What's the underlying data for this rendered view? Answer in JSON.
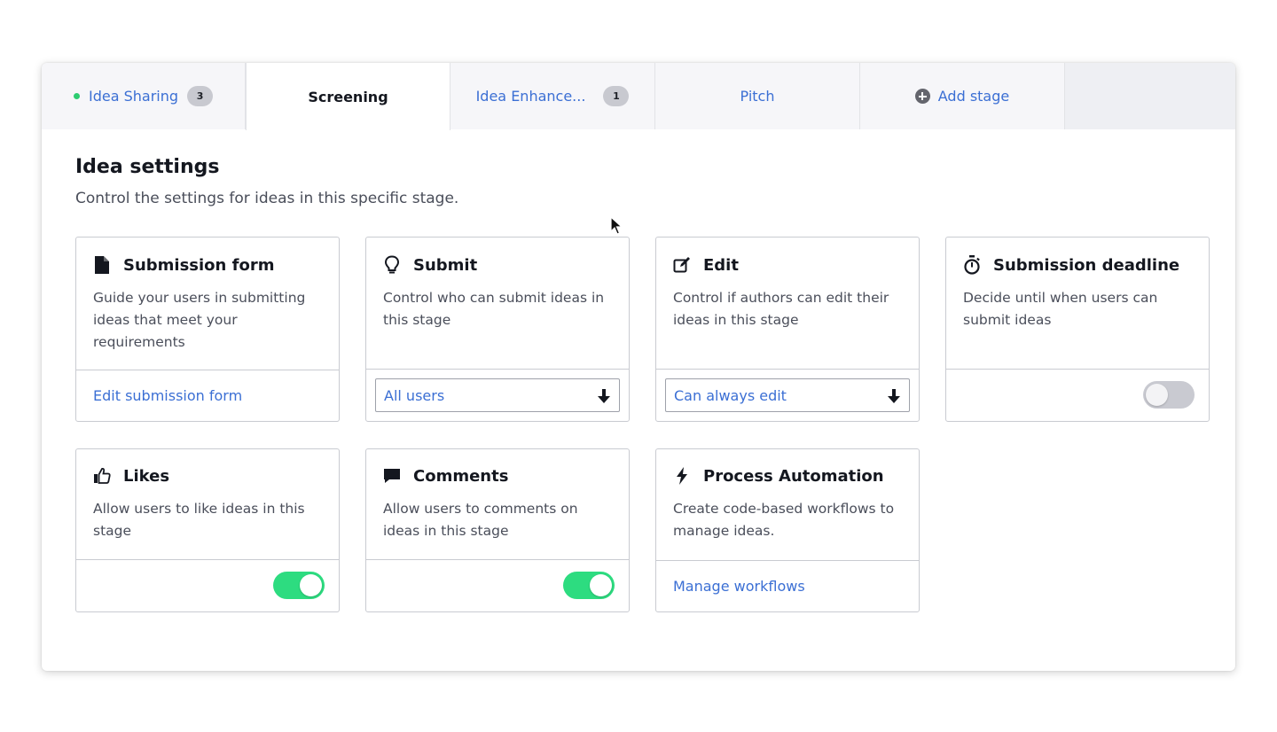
{
  "tabs": [
    {
      "label": "Idea Sharing",
      "badge": "3",
      "status_color": "#2ecc71"
    },
    {
      "label": "Screening",
      "active": true
    },
    {
      "label": "Idea Enhance...",
      "badge": "1"
    },
    {
      "label": "Pitch"
    },
    {
      "label": "Add stage",
      "icon": "plus-circle-icon"
    }
  ],
  "header": {
    "title": "Idea settings",
    "subtitle": "Control the settings for ideas in this specific stage."
  },
  "cards": {
    "submission_form": {
      "icon": "document-icon",
      "title": "Submission form",
      "description": "Guide your users in submitting ideas that meet your requirements",
      "link": "Edit submission form"
    },
    "submit": {
      "icon": "lightbulb-icon",
      "title": "Submit",
      "description": "Control who can submit ideas in this stage",
      "select_value": "All users"
    },
    "edit": {
      "icon": "edit-icon",
      "title": "Edit",
      "description": "Control if authors can edit their ideas in this stage",
      "select_value": "Can always edit"
    },
    "submission_deadline": {
      "icon": "stopwatch-icon",
      "title": "Submission deadline",
      "description": "Decide until when users can submit ideas",
      "toggle_on": false
    },
    "likes": {
      "icon": "thumbs-up-icon",
      "title": "Likes",
      "description": "Allow users to like ideas in this stage",
      "toggle_on": true
    },
    "comments": {
      "icon": "comment-icon",
      "title": "Comments",
      "description": "Allow users to comments on ideas in this stage",
      "toggle_on": true
    },
    "process_automation": {
      "icon": "bolt-icon",
      "title": "Process Automation",
      "description": "Create code-based workflows to manage ideas.",
      "link": "Manage workflows"
    }
  },
  "colors": {
    "accent": "#3b6fd4",
    "toggle_on": "#2ddc80",
    "toggle_off": "#c9cad1"
  }
}
